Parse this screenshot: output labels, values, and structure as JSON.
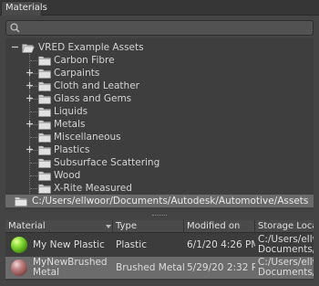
{
  "panel": {
    "tab_label": "Materials"
  },
  "search": {
    "value": "",
    "placeholder": ""
  },
  "tree": {
    "root": {
      "label": "VRED Example Assets"
    },
    "items": [
      {
        "label": "Carbon Fibre",
        "expandable": false
      },
      {
        "label": "Carpaints",
        "expandable": true
      },
      {
        "label": "Cloth and Leather",
        "expandable": true
      },
      {
        "label": "Glass and Gems",
        "expandable": true
      },
      {
        "label": "Liquids",
        "expandable": false
      },
      {
        "label": "Metals",
        "expandable": true
      },
      {
        "label": "Miscellaneous",
        "expandable": false
      },
      {
        "label": "Plastics",
        "expandable": true
      },
      {
        "label": "Subsurface Scattering",
        "expandable": false
      },
      {
        "label": "Wood",
        "expandable": false
      },
      {
        "label": "X-Rite Measured",
        "expandable": false
      }
    ],
    "path": {
      "label": "C:/Users/ellwoor/Documents/Autodesk/Automotive/Assets"
    }
  },
  "table": {
    "columns": {
      "material": "Material",
      "type": "Type",
      "modified": "Modified on",
      "storage": "Storage Locatio"
    },
    "rows": [
      {
        "name_line1": "My New Plastic",
        "name_line2": "",
        "type": "Plastic",
        "modified": "6/1/20 4:26 PM",
        "storage_line1": "C:/Users/ellwo",
        "storage_line2": "Documents/...",
        "ball_color": "#6fc92a"
      },
      {
        "name_line1": "MyNewBrushed",
        "name_line2": "Metal",
        "type": "Brushed Metal",
        "modified": "5/29/20 2:32 PM",
        "storage_line1": "C:/Users/ellwo",
        "storage_line2": "Documents/...",
        "ball_color": "#b06a6a"
      }
    ]
  },
  "colors": {
    "background": "#444444",
    "selected_row": "#6a6a6a",
    "tree_bg": "#3e3e3e"
  }
}
